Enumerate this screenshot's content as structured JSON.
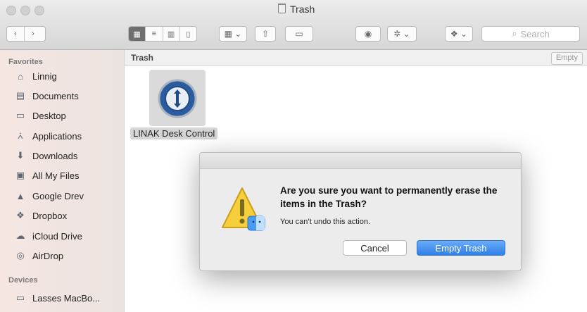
{
  "window": {
    "title": "Trash"
  },
  "toolbar": {
    "search_placeholder": "Search"
  },
  "sidebar": {
    "favorites_header": "Favorites",
    "favorites": [
      {
        "label": "Linnig",
        "icon": "home-icon"
      },
      {
        "label": "Documents",
        "icon": "documents-icon"
      },
      {
        "label": "Desktop",
        "icon": "desktop-icon"
      },
      {
        "label": "Applications",
        "icon": "applications-icon"
      },
      {
        "label": "Downloads",
        "icon": "downloads-icon"
      },
      {
        "label": "All My Files",
        "icon": "all-files-icon"
      },
      {
        "label": "Google Drev",
        "icon": "google-drive-icon"
      },
      {
        "label": "Dropbox",
        "icon": "dropbox-icon"
      },
      {
        "label": "iCloud Drive",
        "icon": "icloud-icon"
      },
      {
        "label": "AirDrop",
        "icon": "airdrop-icon"
      }
    ],
    "devices_header": "Devices",
    "devices": [
      {
        "label": "Lasses MacBo...",
        "icon": "laptop-icon"
      }
    ]
  },
  "content": {
    "path_label": "Trash",
    "empty_button": "Empty",
    "files": [
      {
        "name": "LINAK Desk Control"
      }
    ]
  },
  "dialog": {
    "title": "Are you sure you want to permanently erase the items in the Trash?",
    "message": "You can’t undo this action.",
    "cancel_label": "Cancel",
    "confirm_label": "Empty Trash",
    "accent_color": "#3a86f0"
  }
}
